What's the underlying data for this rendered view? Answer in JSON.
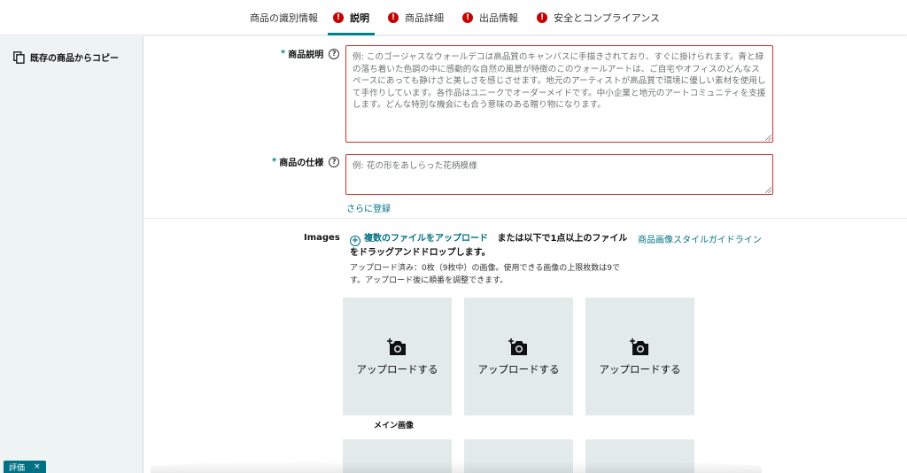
{
  "tabs": [
    {
      "label": "商品の識別情報",
      "alert": false,
      "active": false
    },
    {
      "label": "説明",
      "alert": true,
      "active": true
    },
    {
      "label": "商品詳細",
      "alert": true,
      "active": false
    },
    {
      "label": "出品情報",
      "alert": true,
      "active": false
    },
    {
      "label": "安全とコンプライアンス",
      "alert": true,
      "active": false
    }
  ],
  "alert_glyph": "!",
  "sidebar": {
    "copy_label": "既存の商品からコピー",
    "copy_icon": "copy-icon"
  },
  "description": {
    "required_mark": "*",
    "label": "商品説明",
    "help_glyph": "?",
    "value": "",
    "placeholder": "例: このゴージャスなウォールデコは高品質のキャンバスに手描きされており、すぐに掛けられます。青と緑の落ち着いた色調の中に感動的な自然の風景が特徴のこのウォールアートは、ご自宅やオフィスのどんなスペースにあっても静けさと美しさを感じさせます。地元のアーティストが高品質で環境に優しい素材を使用して手作りしています。各作品はユニークでオーダーメイドです。中小企業と地元のアートコミュニティを支援します。どんな特別な機会にも合う意味のある贈り物になります。"
  },
  "spec": {
    "required_mark": "*",
    "label": "商品の仕様",
    "help_glyph": "?",
    "value": "",
    "placeholder": "例: 花の形をあしらった花柄模様"
  },
  "add_more": "さらに登録",
  "images": {
    "label": "Images",
    "plus_glyph": "+",
    "upload_link": "複数のファイルをアップロード",
    "upload_text": "または以下で1点以上のファイルをドラッグアンドドロップします。",
    "style_guide_link": "商品画像スタイルガイドライン",
    "uploaded_note": "アップロード済み：0枚（9枚中）の画像。使用できる画像の上限枚数は9です。アップロード後に順番を調整できます。",
    "slot_label": "アップロードする",
    "slot_icon": "camera-plus-icon",
    "main_image_label": "メイン画像",
    "slots": [
      {
        "label": "アップロードする"
      },
      {
        "label": "アップロードする"
      },
      {
        "label": "アップロードする"
      }
    ]
  },
  "feedback": {
    "label": "評価",
    "close": "×"
  },
  "colors": {
    "accent": "#00828a",
    "link": "#007185",
    "alert": "#c40000",
    "error_border": "#d0312d",
    "sidebar_bg": "#eef3f3",
    "slot_bg": "#e3eaea"
  }
}
